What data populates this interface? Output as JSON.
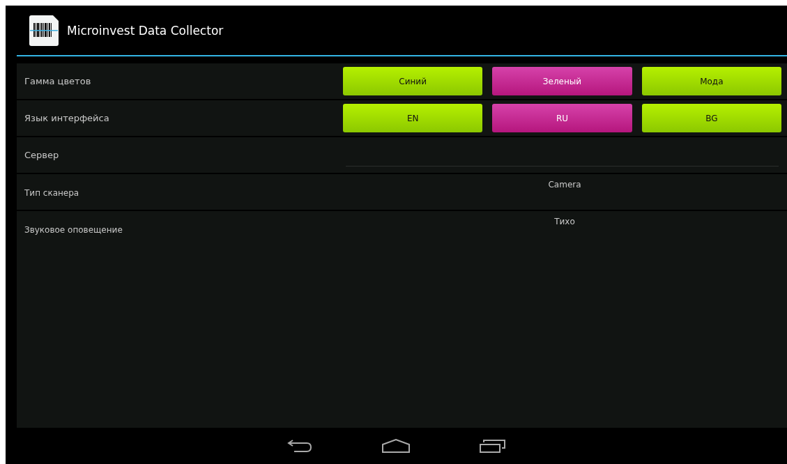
{
  "action_bar": {
    "title": "Microinvest Data Collector"
  },
  "settings": [
    {
      "kind": "choices",
      "label": "Гамма цветов",
      "options": [
        {
          "label": "Синий",
          "selected": false
        },
        {
          "label": "Зеленый",
          "selected": true
        },
        {
          "label": "Мода",
          "selected": false
        }
      ]
    },
    {
      "kind": "choices",
      "label": "Язык интерфейса",
      "options": [
        {
          "label": "EN",
          "selected": false
        },
        {
          "label": "RU",
          "selected": true
        },
        {
          "label": "BG",
          "selected": false
        }
      ]
    },
    {
      "kind": "field",
      "label": "Сервер"
    },
    {
      "kind": "value",
      "label": "Тип сканера",
      "value": "Camera"
    },
    {
      "kind": "value",
      "label": "Звуковое оповещение",
      "value": "Тихо"
    }
  ]
}
